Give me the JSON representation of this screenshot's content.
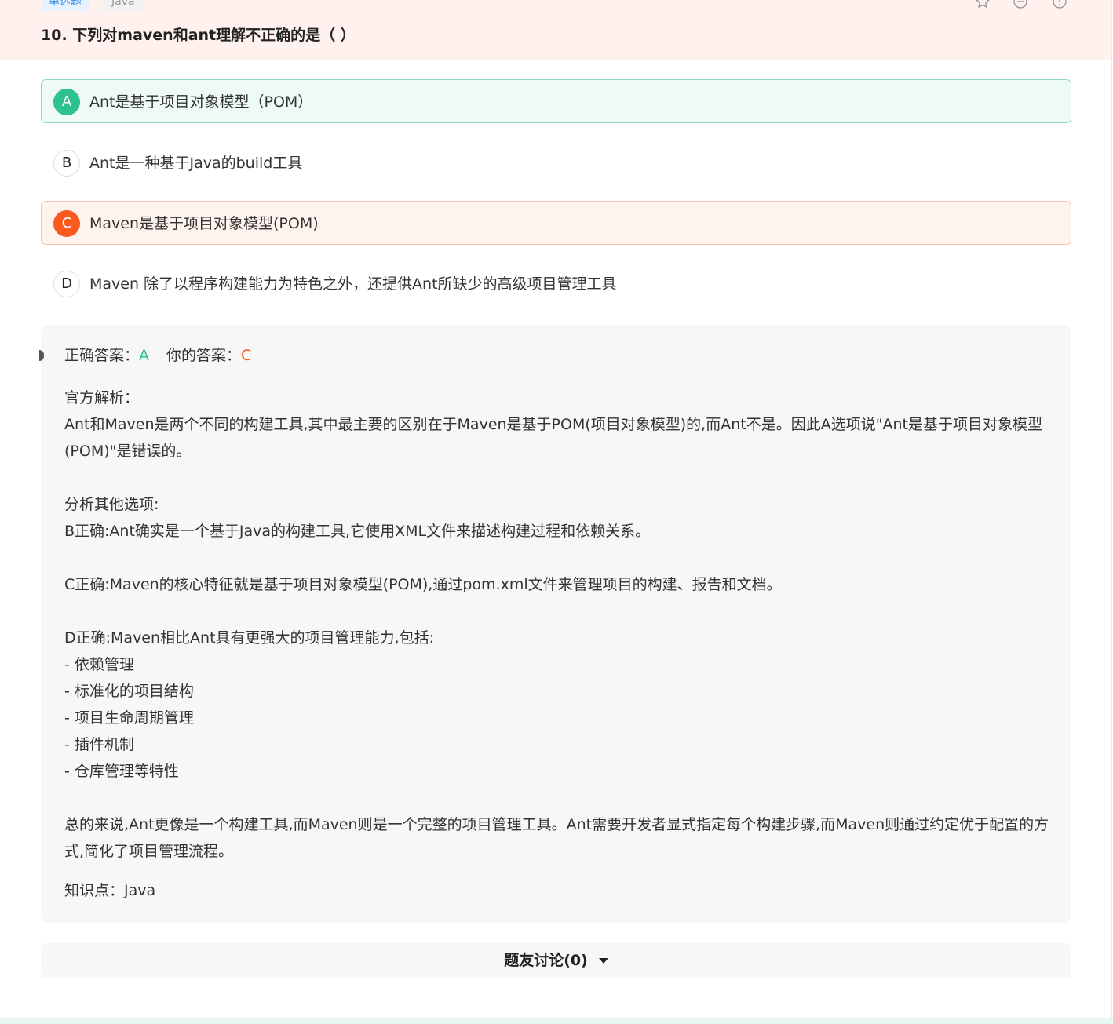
{
  "question": {
    "type_tag": "单选题",
    "topic_tag": "Java",
    "title": "10. 下列对maven和ant理解不正确的是（ ）"
  },
  "header_icons": [
    "star-icon",
    "minus-circle-icon",
    "info-circle-icon"
  ],
  "options": [
    {
      "letter": "A",
      "text": "Ant是基于项目对象模型（POM）",
      "state": "correct"
    },
    {
      "letter": "B",
      "text": "Ant是一种基于Java的build工具",
      "state": "normal"
    },
    {
      "letter": "C",
      "text": "Maven是基于项目对象模型(POM)",
      "state": "wrong"
    },
    {
      "letter": "D",
      "text": "Maven 除了以程序构建能力为特色之外，还提供Ant所缺少的高级项目管理工具",
      "state": "normal"
    }
  ],
  "answer": {
    "correct_label": "正确答案：",
    "correct_value": "A",
    "yours_label": "你的答案：",
    "yours_value": "C"
  },
  "explanation": "官方解析：\nAnt和Maven是两个不同的构建工具,其中最主要的区别在于Maven是基于POM(项目对象模型)的,而Ant不是。因此A选项说\"Ant是基于项目对象模型(POM)\"是错误的。\n\n分析其他选项:\nB正确:Ant确实是一个基于Java的构建工具,它使用XML文件来描述构建过程和依赖关系。\n\nC正确:Maven的核心特征就是基于项目对象模型(POM),通过pom.xml文件来管理项目的构建、报告和文档。\n\nD正确:Maven相比Ant具有更强大的项目管理能力,包括:\n- 依赖管理\n- 标准化的项目结构\n- 项目生命周期管理\n- 插件机制\n- 仓库管理等特性\n\n总的来说,Ant更像是一个构建工具,而Maven则是一个完整的项目管理工具。Ant需要开发者显式指定每个构建步骤,而Maven则通过约定优于配置的方式,简化了项目管理流程。",
  "knowledge": "知识点：Java",
  "discussion": {
    "label": "题友讨论(0)"
  },
  "colors": {
    "correct": "#2ec28f",
    "wrong": "#fa5a1e",
    "header_bg": "#fff2ee",
    "panel_bg": "#f7f7f7"
  }
}
